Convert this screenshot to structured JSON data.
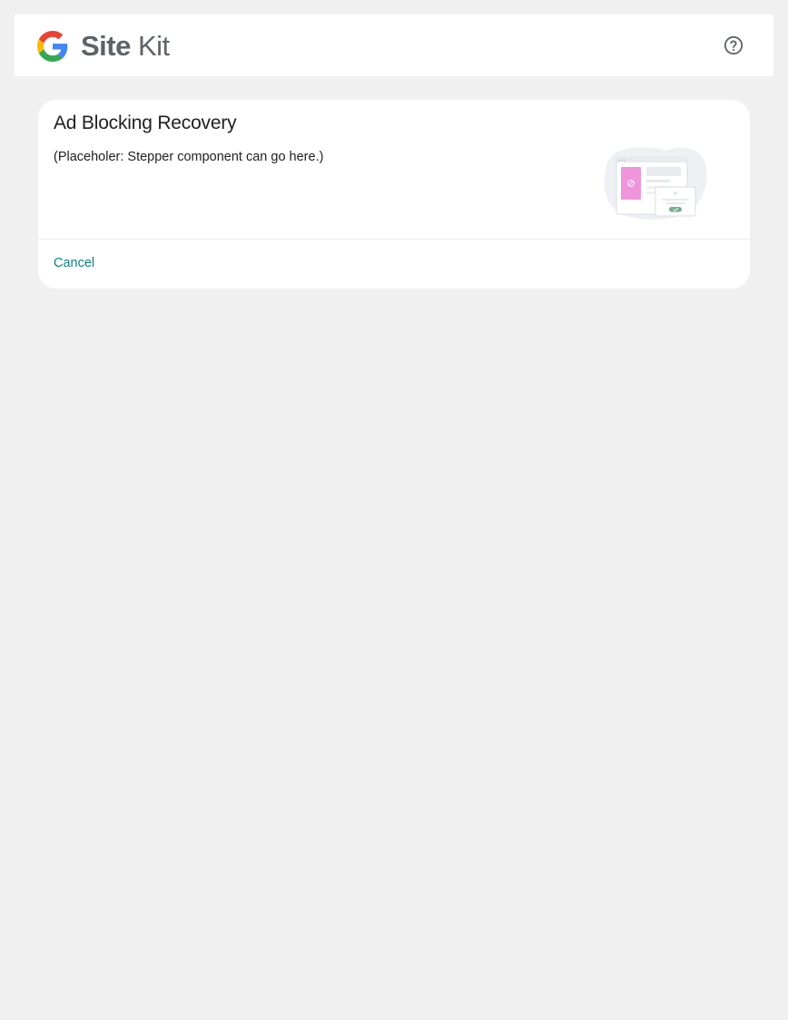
{
  "header": {
    "logo_site": "Site",
    "logo_kit": "Kit",
    "help_icon": "help-circle-icon"
  },
  "card": {
    "title": "Ad Blocking Recovery",
    "body_text": "(Placeholer: Stepper component can go here.)",
    "illustration": "ad-blocking-recovery-illustration",
    "cancel_label": "Cancel"
  },
  "colors": {
    "page_background": "#f0f0f0",
    "surface": "#ffffff",
    "text_primary": "#202124",
    "logo_text": "#5f6368",
    "link": "#108080",
    "illustration_pink": "#f094dc",
    "illustration_green": "#77ad8c"
  }
}
